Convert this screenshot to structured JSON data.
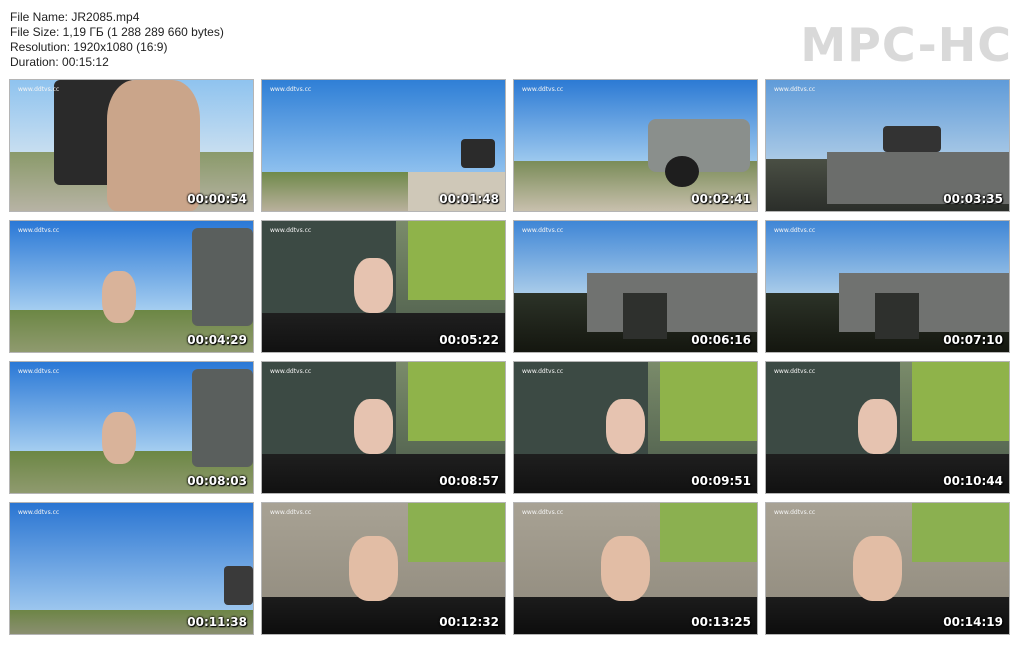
{
  "info": {
    "file_name": "File Name: JR2085.mp4",
    "file_size": "File Size: 1,19 ГБ (1 288 289 660 bytes)",
    "resolution": "Resolution: 1920x1080 (16:9)",
    "duration": "Duration: 00:15:12"
  },
  "logo": "MPC-HC",
  "watermark": "www.ddtvs.cc",
  "thumbnails": [
    {
      "time": "00:00:54",
      "scene": "closeup"
    },
    {
      "time": "00:01:48",
      "scene": "far"
    },
    {
      "time": "00:02:41",
      "scene": "truck"
    },
    {
      "time": "00:03:35",
      "scene": "bridge"
    },
    {
      "time": "00:04:29",
      "scene": "crane"
    },
    {
      "time": "00:05:22",
      "scene": "water"
    },
    {
      "time": "00:06:16",
      "scene": "bridge2"
    },
    {
      "time": "00:07:10",
      "scene": "bridge2"
    },
    {
      "time": "00:08:03",
      "scene": "crane"
    },
    {
      "time": "00:08:57",
      "scene": "water"
    },
    {
      "time": "00:09:51",
      "scene": "water"
    },
    {
      "time": "00:10:44",
      "scene": "water"
    },
    {
      "time": "00:11:38",
      "scene": "sky"
    },
    {
      "time": "00:12:32",
      "scene": "concrete"
    },
    {
      "time": "00:13:25",
      "scene": "concrete"
    },
    {
      "time": "00:14:19",
      "scene": "concrete"
    }
  ]
}
